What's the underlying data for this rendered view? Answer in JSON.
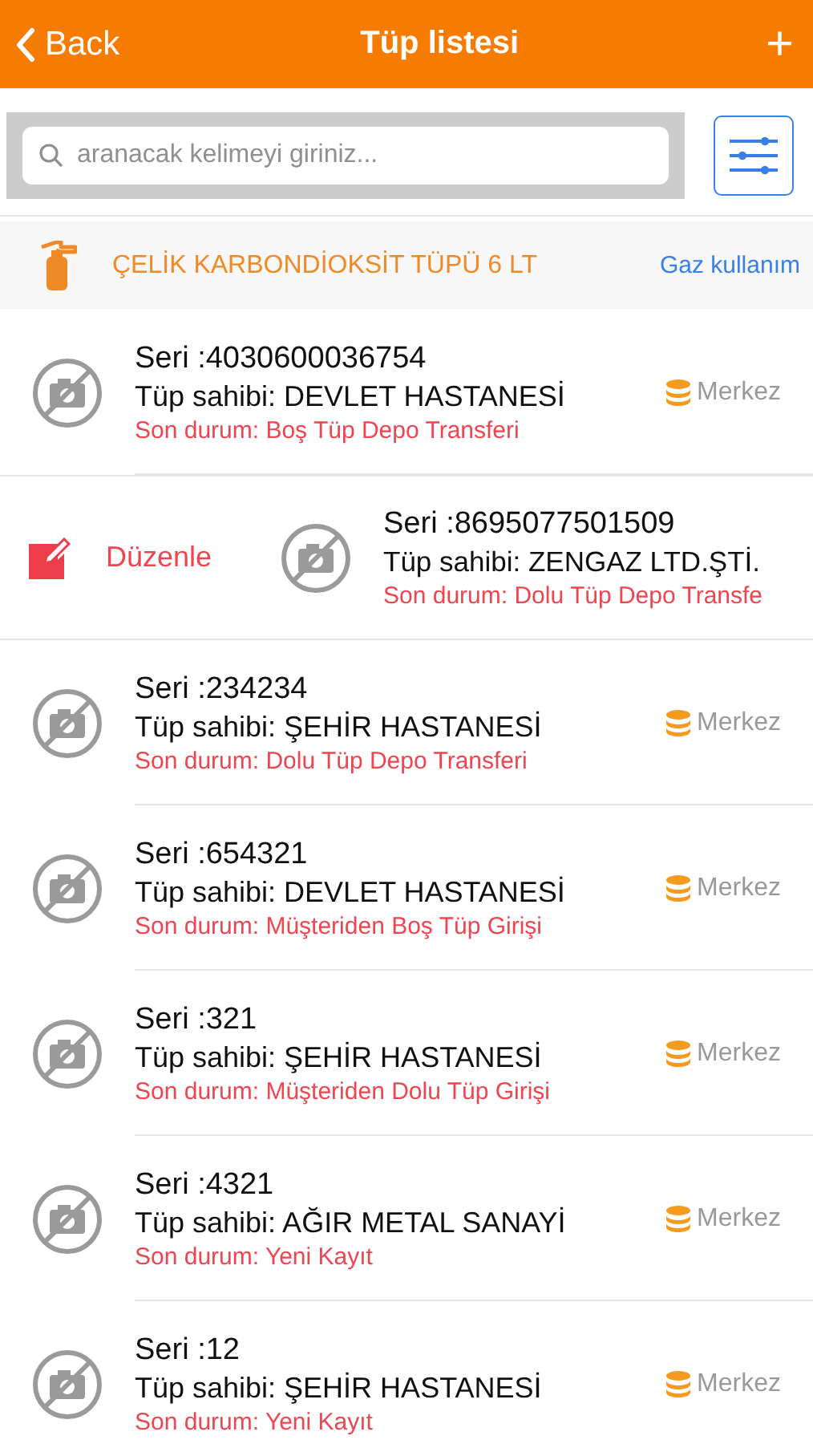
{
  "nav": {
    "back": "Back",
    "title": "Tüp listesi",
    "add": "+"
  },
  "search": {
    "placeholder": "aranacak kelimeyi giriniz..."
  },
  "category": {
    "name": "ÇELİK KARBONDİOKSİT TÜPÜ 6 LT",
    "link": "Gaz kullanım"
  },
  "rows": [
    {
      "seri": "Seri :4030600036754",
      "owner": "Tüp sahibi: DEVLET HASTANESİ",
      "status": "Son durum: Boş Tüp Depo Transferi",
      "location": "Merkez",
      "swiped": false
    },
    {
      "seri": "Seri :8695077501509",
      "owner": "Tüp sahibi: ZENGAZ LTD.ŞTİ.",
      "status": "Son durum: Dolu Tüp Depo Transfe",
      "action": "Düzenle",
      "swiped": true
    },
    {
      "seri": "Seri :234234",
      "owner": "Tüp sahibi: ŞEHİR HASTANESİ",
      "status": "Son durum: Dolu Tüp Depo Transferi",
      "location": "Merkez",
      "swiped": false
    },
    {
      "seri": "Seri :654321",
      "owner": "Tüp sahibi: DEVLET HASTANESİ",
      "status": "Son durum: Müşteriden Boş Tüp Girişi",
      "location": "Merkez",
      "swiped": false
    },
    {
      "seri": "Seri :321",
      "owner": "Tüp sahibi: ŞEHİR HASTANESİ",
      "status": "Son durum: Müşteriden Dolu Tüp Girişi",
      "location": "Merkez",
      "swiped": false
    },
    {
      "seri": "Seri :4321",
      "owner": "Tüp sahibi: AĞIR METAL SANAYİ",
      "status": "Son durum: Yeni Kayıt",
      "location": "Merkez",
      "swiped": false
    },
    {
      "seri": "Seri :12",
      "owner": "Tüp sahibi: ŞEHİR HASTANESİ",
      "status": "Son durum: Yeni Kayıt",
      "location": "Merkez",
      "swiped": false
    }
  ]
}
